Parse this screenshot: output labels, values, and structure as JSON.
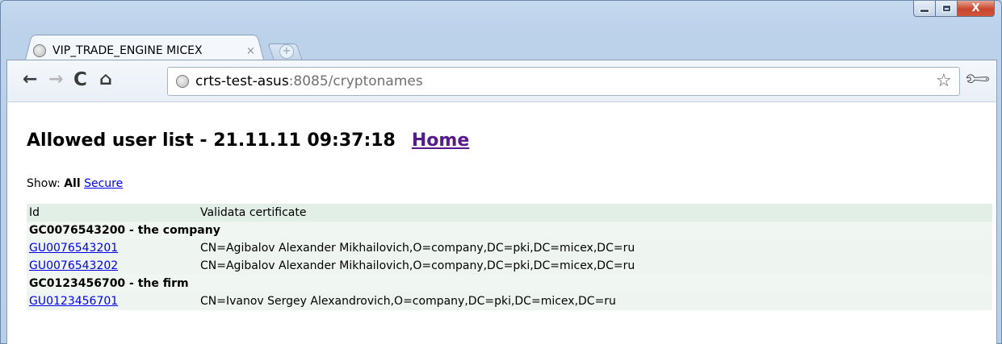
{
  "browser": {
    "tab_title": "VIP_TRADE_ENGINE MICEX",
    "tab_close": "×",
    "url_host": "crts-test-asus",
    "url_rest": ":8085/cryptonames",
    "window_controls": {
      "minimize": "",
      "maximize": "",
      "close": "X"
    }
  },
  "page": {
    "heading": "Allowed user list - 21.11.11 09:37:18",
    "home_link": "Home",
    "show_label": "Show:",
    "show_current": "All",
    "show_secure": "Secure"
  },
  "table": {
    "headers": [
      "Id",
      "Validata certificate"
    ],
    "groups": [
      {
        "title": "GC0076543200 - the company",
        "rows": [
          {
            "id": "GU0076543201",
            "cert": "CN=Agibalov Alexander Mikhailovich,O=company,DC=pki,DC=micex,DC=ru"
          },
          {
            "id": "GU0076543202",
            "cert": "CN=Agibalov Alexander Mikhailovich,O=company,DC=pki,DC=micex,DC=ru"
          }
        ]
      },
      {
        "title": "GC0123456700 - the firm",
        "rows": [
          {
            "id": "GU0123456701",
            "cert": "CN=Ivanov Sergey Alexandrovich,O=company,DC=pki,DC=micex,DC=ru"
          }
        ]
      }
    ]
  }
}
